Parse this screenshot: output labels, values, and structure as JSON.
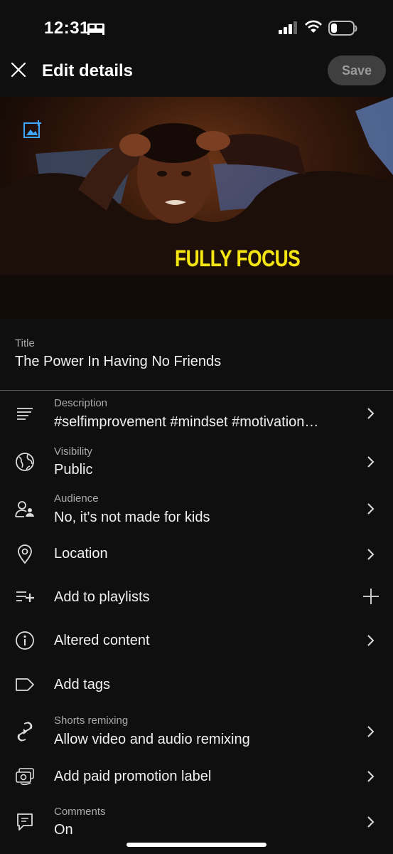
{
  "status_bar": {
    "time": "12:31"
  },
  "header": {
    "title": "Edit details",
    "save_label": "Save"
  },
  "thumbnail": {
    "overlay_text": "FULLY FOCUS"
  },
  "title_field": {
    "label": "Title",
    "value": "The Power In Having No Friends"
  },
  "rows": [
    {
      "label": "Description",
      "value": "#selfimprovement #mindset #motivation…",
      "icon": "description-icon",
      "action": "chevron"
    },
    {
      "label": "Visibility",
      "value": "Public",
      "icon": "globe-icon",
      "action": "chevron"
    },
    {
      "label": "Audience",
      "value": "No, it's not made for kids",
      "icon": "audience-icon",
      "action": "chevron"
    },
    {
      "label": "",
      "value": "Location",
      "icon": "location-pin-icon",
      "action": "chevron"
    },
    {
      "label": "",
      "value": "Add to playlists",
      "icon": "playlist-add-icon",
      "action": "plus"
    },
    {
      "label": "",
      "value": "Altered content",
      "icon": "info-icon",
      "action": "chevron"
    },
    {
      "label": "",
      "value": "Add tags",
      "icon": "tag-icon",
      "action": "none"
    },
    {
      "label": "Shorts remixing",
      "value": "Allow video and audio remixing",
      "icon": "shorts-remix-icon",
      "action": "chevron"
    },
    {
      "label": "",
      "value": "Add paid promotion label",
      "icon": "paid-promotion-icon",
      "action": "chevron"
    },
    {
      "label": "Comments",
      "value": "On",
      "icon": "comments-icon",
      "action": "chevron"
    }
  ]
}
